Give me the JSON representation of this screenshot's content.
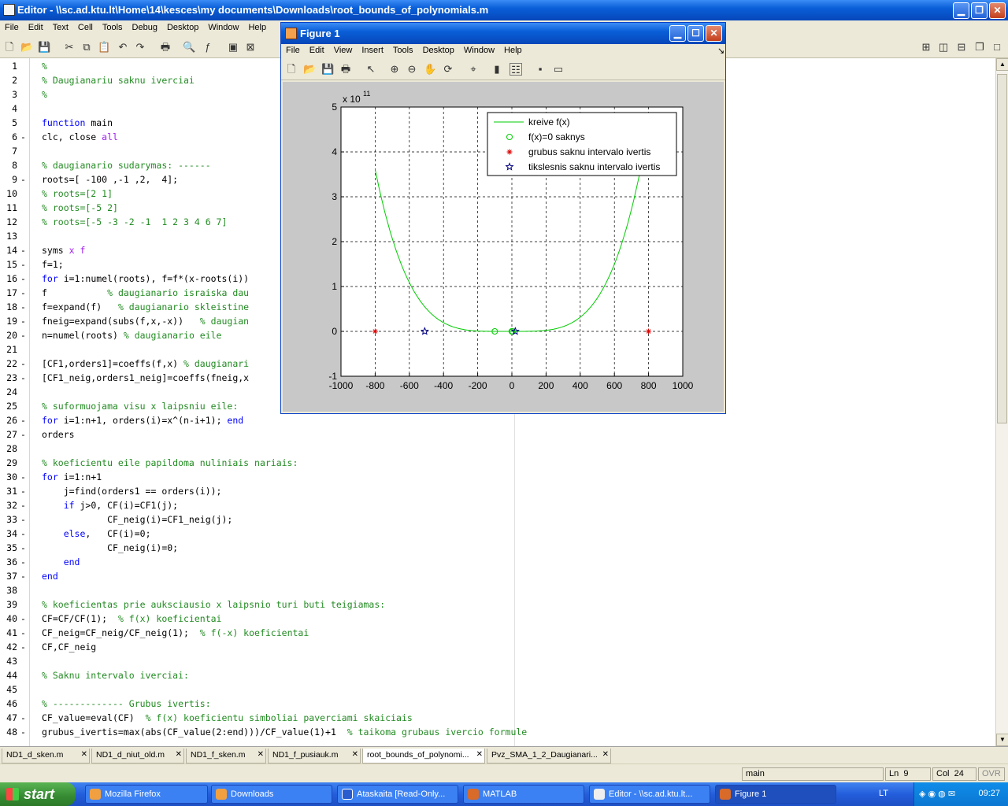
{
  "editor": {
    "title": "Editor - \\\\sc.ad.ktu.lt\\Home\\14\\kesces\\my documents\\Downloads\\root_bounds_of_polynomials.m",
    "menu": [
      "File",
      "Edit",
      "Text",
      "Cell",
      "Tools",
      "Debug",
      "Desktop",
      "Window",
      "Help"
    ]
  },
  "code_lines": [
    {
      "n": "1",
      "dash": "",
      "segs": [
        {
          "t": "%",
          "c": "comment"
        }
      ]
    },
    {
      "n": "2",
      "dash": "",
      "segs": [
        {
          "t": "% Daugianariu saknu iverciai",
          "c": "comment"
        }
      ]
    },
    {
      "n": "3",
      "dash": "",
      "segs": [
        {
          "t": "%",
          "c": "comment"
        }
      ]
    },
    {
      "n": "4",
      "dash": "",
      "segs": []
    },
    {
      "n": "5",
      "dash": "",
      "segs": [
        {
          "t": "function",
          "c": "keyword"
        },
        {
          "t": " main",
          "c": "plain"
        }
      ]
    },
    {
      "n": "6",
      "dash": "-",
      "segs": [
        {
          "t": "clc, close ",
          "c": "plain"
        },
        {
          "t": "all",
          "c": "string"
        }
      ]
    },
    {
      "n": "7",
      "dash": "",
      "segs": []
    },
    {
      "n": "8",
      "dash": "",
      "segs": [
        {
          "t": "% daugianario sudarymas: ------",
          "c": "comment"
        }
      ]
    },
    {
      "n": "9",
      "dash": "-",
      "segs": [
        {
          "t": "roots=[ -100 ,-1 ,2,  4];",
          "c": "plain"
        }
      ]
    },
    {
      "n": "10",
      "dash": "",
      "segs": [
        {
          "t": "% roots=[2 1]",
          "c": "comment"
        }
      ]
    },
    {
      "n": "11",
      "dash": "",
      "segs": [
        {
          "t": "% roots=[-5 2]",
          "c": "comment"
        }
      ]
    },
    {
      "n": "12",
      "dash": "",
      "segs": [
        {
          "t": "% roots=[-5 -3 -2 -1  1 2 3 4 6 7]",
          "c": "comment"
        }
      ]
    },
    {
      "n": "13",
      "dash": "",
      "segs": []
    },
    {
      "n": "14",
      "dash": "-",
      "segs": [
        {
          "t": "syms ",
          "c": "plain"
        },
        {
          "t": "x f",
          "c": "string"
        }
      ]
    },
    {
      "n": "15",
      "dash": "-",
      "segs": [
        {
          "t": "f=1;",
          "c": "plain"
        }
      ]
    },
    {
      "n": "16",
      "dash": "-",
      "segs": [
        {
          "t": "for",
          "c": "keyword"
        },
        {
          "t": " i=1:numel(roots), f=f*(x-roots(i))",
          "c": "plain"
        }
      ]
    },
    {
      "n": "17",
      "dash": "-",
      "segs": [
        {
          "t": "f           ",
          "c": "plain"
        },
        {
          "t": "% daugianario israiska dau",
          "c": "comment"
        }
      ]
    },
    {
      "n": "18",
      "dash": "-",
      "segs": [
        {
          "t": "f=expand(f)   ",
          "c": "plain"
        },
        {
          "t": "% daugianario skleistine",
          "c": "comment"
        }
      ]
    },
    {
      "n": "19",
      "dash": "-",
      "segs": [
        {
          "t": "fneig=expand(subs(f,x,-x))   ",
          "c": "plain"
        },
        {
          "t": "% daugian",
          "c": "comment"
        }
      ]
    },
    {
      "n": "20",
      "dash": "-",
      "segs": [
        {
          "t": "n=numel(roots) ",
          "c": "plain"
        },
        {
          "t": "% daugianario eile",
          "c": "comment"
        }
      ]
    },
    {
      "n": "21",
      "dash": "",
      "segs": []
    },
    {
      "n": "22",
      "dash": "-",
      "segs": [
        {
          "t": "[CF1,orders1]=coeffs(f,x) ",
          "c": "plain"
        },
        {
          "t": "% daugianari",
          "c": "comment"
        }
      ]
    },
    {
      "n": "23",
      "dash": "-",
      "segs": [
        {
          "t": "[CF1_neig,orders1_neig]=coeffs(fneig,x",
          "c": "plain"
        }
      ]
    },
    {
      "n": "24",
      "dash": "",
      "segs": []
    },
    {
      "n": "25",
      "dash": "",
      "segs": [
        {
          "t": "% suformuojama visu x laipsniu eile:",
          "c": "comment"
        }
      ]
    },
    {
      "n": "26",
      "dash": "-",
      "segs": [
        {
          "t": "for",
          "c": "keyword"
        },
        {
          "t": " i=1:n+1, orders(i)=x^(n-i+1); ",
          "c": "plain"
        },
        {
          "t": "end",
          "c": "keyword"
        }
      ]
    },
    {
      "n": "27",
      "dash": "-",
      "segs": [
        {
          "t": "orders",
          "c": "plain"
        }
      ]
    },
    {
      "n": "28",
      "dash": "",
      "segs": []
    },
    {
      "n": "29",
      "dash": "",
      "segs": [
        {
          "t": "% koeficientu eile papildoma nuliniais nariais:",
          "c": "comment"
        }
      ]
    },
    {
      "n": "30",
      "dash": "-",
      "segs": [
        {
          "t": "for",
          "c": "keyword"
        },
        {
          "t": " i=1:n+1",
          "c": "plain"
        }
      ]
    },
    {
      "n": "31",
      "dash": "-",
      "segs": [
        {
          "t": "    j=find(orders1 == orders(i));",
          "c": "plain"
        }
      ]
    },
    {
      "n": "32",
      "dash": "-",
      "segs": [
        {
          "t": "    ",
          "c": "plain"
        },
        {
          "t": "if",
          "c": "keyword"
        },
        {
          "t": " j>0, CF(i)=CF1(j);",
          "c": "plain"
        }
      ]
    },
    {
      "n": "33",
      "dash": "-",
      "segs": [
        {
          "t": "            CF_neig(i)=CF1_neig(j);",
          "c": "plain"
        }
      ]
    },
    {
      "n": "34",
      "dash": "-",
      "segs": [
        {
          "t": "    ",
          "c": "plain"
        },
        {
          "t": "else",
          "c": "keyword"
        },
        {
          "t": ",   CF(i)=0;",
          "c": "plain"
        }
      ]
    },
    {
      "n": "35",
      "dash": "-",
      "segs": [
        {
          "t": "            CF_neig(i)=0;",
          "c": "plain"
        }
      ]
    },
    {
      "n": "36",
      "dash": "-",
      "segs": [
        {
          "t": "    ",
          "c": "plain"
        },
        {
          "t": "end",
          "c": "keyword"
        }
      ]
    },
    {
      "n": "37",
      "dash": "-",
      "segs": [
        {
          "t": "end",
          "c": "keyword"
        }
      ]
    },
    {
      "n": "38",
      "dash": "",
      "segs": []
    },
    {
      "n": "39",
      "dash": "",
      "segs": [
        {
          "t": "% koeficientas prie auksciausio x laipsnio turi buti teigiamas:",
          "c": "comment"
        }
      ]
    },
    {
      "n": "40",
      "dash": "-",
      "segs": [
        {
          "t": "CF=CF/CF(1);  ",
          "c": "plain"
        },
        {
          "t": "% f(x) koeficientai",
          "c": "comment"
        }
      ]
    },
    {
      "n": "41",
      "dash": "-",
      "segs": [
        {
          "t": "CF_neig=CF_neig/CF_neig(1);  ",
          "c": "plain"
        },
        {
          "t": "% f(-x) koeficientai",
          "c": "comment"
        }
      ]
    },
    {
      "n": "42",
      "dash": "-",
      "segs": [
        {
          "t": "CF,CF_neig",
          "c": "plain"
        }
      ]
    },
    {
      "n": "43",
      "dash": "",
      "segs": []
    },
    {
      "n": "44",
      "dash": "",
      "segs": [
        {
          "t": "% Saknu intervalo iverciai:",
          "c": "comment"
        }
      ]
    },
    {
      "n": "45",
      "dash": "",
      "segs": []
    },
    {
      "n": "46",
      "dash": "",
      "segs": [
        {
          "t": "% ------------- Grubus ivertis:",
          "c": "comment"
        }
      ]
    },
    {
      "n": "47",
      "dash": "-",
      "segs": [
        {
          "t": "CF_value=eval(CF)  ",
          "c": "plain"
        },
        {
          "t": "% f(x) koeficientu simboliai paverciami skaiciais",
          "c": "comment"
        }
      ]
    },
    {
      "n": "48",
      "dash": "-",
      "segs": [
        {
          "t": "grubus_ivertis=max(abs(CF_value(2:end)))/CF_value(1)+1  ",
          "c": "plain"
        },
        {
          "t": "% taikoma grubaus ivercio formule",
          "c": "comment"
        }
      ]
    }
  ],
  "file_tabs": [
    {
      "label": "ND1_d_sken.m",
      "active": false
    },
    {
      "label": "ND1_d_niut_old.m",
      "active": false
    },
    {
      "label": "ND1_f_sken.m",
      "active": false
    },
    {
      "label": "ND1_f_pusiauk.m",
      "active": false
    },
    {
      "label": "root_bounds_of_polynomi...",
      "active": true
    },
    {
      "label": "Pvz_SMA_1_2_Daugianari...",
      "active": false
    }
  ],
  "status": {
    "function": "main",
    "ln_label": "Ln",
    "ln": "9",
    "col_label": "Col",
    "col": "24",
    "ovr": "OVR"
  },
  "taskbar": {
    "start": "start",
    "tasks": [
      {
        "label": "Mozilla Firefox",
        "active": false
      },
      {
        "label": "Downloads",
        "active": false
      },
      {
        "label": "Ataskaita [Read-Only...",
        "active": false
      },
      {
        "label": "MATLAB",
        "active": false
      },
      {
        "label": "Editor - \\\\sc.ad.ktu.lt...",
        "active": false
      },
      {
        "label": "Figure 1",
        "active": true
      }
    ],
    "lang": "LT",
    "clock": "09:27"
  },
  "figure": {
    "title": "Figure 1",
    "menu": [
      "File",
      "Edit",
      "View",
      "Insert",
      "Tools",
      "Desktop",
      "Window",
      "Help"
    ]
  },
  "chart_data": {
    "type": "line",
    "title": "",
    "xlabel": "",
    "ylabel": "",
    "exponent_label": "x 10",
    "exponent_power": "11",
    "xlim": [
      -1000,
      1000
    ],
    "ylim": [
      -1,
      5
    ],
    "xticks": [
      -1000,
      -800,
      -600,
      -400,
      -200,
      0,
      200,
      400,
      600,
      800,
      1000
    ],
    "yticks": [
      -1,
      0,
      1,
      2,
      3,
      4,
      5
    ],
    "grid": true,
    "legend_position": "top-right",
    "series": [
      {
        "name": "kreive f(x)",
        "kind": "line",
        "color": "#00cc00",
        "function_roots": [
          -100,
          -1,
          2,
          4
        ],
        "x_range": [
          -800,
          800
        ],
        "scale": 100000000000.0
      },
      {
        "name": "f(x)=0 saknys",
        "kind": "circle",
        "color": "#00cc00",
        "x": [
          -100,
          -1,
          2,
          4
        ],
        "y": [
          0,
          0,
          0,
          0
        ]
      },
      {
        "name": "grubus saknu intervalo ivertis",
        "kind": "star",
        "color": "#dd0000",
        "x": [
          -800,
          800
        ],
        "y": [
          0,
          0
        ]
      },
      {
        "name": "tikslesnis saknu intervalo ivertis",
        "kind": "pentagram",
        "color": "#000080",
        "x": [
          -510,
          20
        ],
        "y": [
          0,
          0
        ]
      }
    ]
  }
}
